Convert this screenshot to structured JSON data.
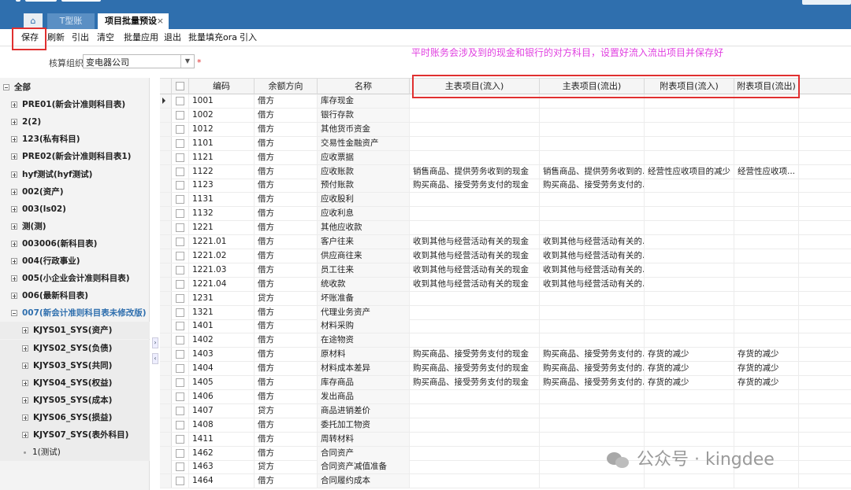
{
  "tabs": {
    "home_icon": "home-icon",
    "t_ledger": "T型账",
    "active": "项目批量预设",
    "close": "×"
  },
  "toolbar": [
    "保存",
    "刷新",
    "引出",
    "清空",
    "批量应用",
    "退出",
    "批量填充ora",
    "引入"
  ],
  "org": {
    "label": "核算组织",
    "value": "变电器公司",
    "required": "*"
  },
  "annotation": "平时账务会涉及到的现金和银行的对方科目，设置好流入流出项目并保存好",
  "tree": [
    {
      "label": "全部",
      "level": 0
    },
    {
      "label": "PRE01(新会计准则科目表)",
      "level": 1
    },
    {
      "label": "2(2)",
      "level": 1
    },
    {
      "label": "123(私有科目)",
      "level": 1
    },
    {
      "label": "PRE02(新会计准则科目表1)",
      "level": 1
    },
    {
      "label": "hyf测试(hyf测试)",
      "level": 1
    },
    {
      "label": "002(资产)",
      "level": 1
    },
    {
      "label": "003(ls02)",
      "level": 1
    },
    {
      "label": "测(测)",
      "level": 1
    },
    {
      "label": "003006(新科目表)",
      "level": 1
    },
    {
      "label": "004(行政事业)",
      "level": 1
    },
    {
      "label": "005(小企业会计准则科目表)",
      "level": 1
    },
    {
      "label": "006(最新科目表)",
      "level": 1
    },
    {
      "label": "007(新会计准则科目表未修改版)",
      "level": 1,
      "selected": true
    },
    {
      "label": "KJYS01_SYS(资产)",
      "level": 2
    },
    {
      "label": "KJYS02_SYS(负债)",
      "level": 2
    },
    {
      "label": "KJYS03_SYS(共同)",
      "level": 2
    },
    {
      "label": "KJYS04_SYS(权益)",
      "level": 2
    },
    {
      "label": "KJYS05_SYS(成本)",
      "level": 2
    },
    {
      "label": "KJYS06_SYS(损益)",
      "level": 2
    },
    {
      "label": "KJYS07_SYS(表外科目)",
      "level": 2
    },
    {
      "label": "1(测试)",
      "level": 3
    }
  ],
  "grid": {
    "headers": [
      "编码",
      "余额方向",
      "名称",
      "主表项目(流入)",
      "主表项目(流出)",
      "附表项目(流入)",
      "附表项目(流出)"
    ],
    "rows": [
      [
        "1001",
        "借方",
        "库存现金",
        "",
        "",
        "",
        ""
      ],
      [
        "1002",
        "借方",
        "银行存款",
        "",
        "",
        "",
        ""
      ],
      [
        "1012",
        "借方",
        "其他货币资金",
        "",
        "",
        "",
        ""
      ],
      [
        "1101",
        "借方",
        "交易性金融资产",
        "",
        "",
        "",
        ""
      ],
      [
        "1121",
        "借方",
        "应收票据",
        "",
        "",
        "",
        ""
      ],
      [
        "1122",
        "借方",
        "应收账款",
        "销售商品、提供劳务收到的现金",
        "销售商品、提供劳务收到的...",
        "经营性应收项目的减少",
        "经营性应收项..."
      ],
      [
        "1123",
        "借方",
        "预付账款",
        "购买商品、接受劳务支付的现金",
        "购买商品、接受劳务支付的...",
        "",
        ""
      ],
      [
        "1131",
        "借方",
        "应收股利",
        "",
        "",
        "",
        ""
      ],
      [
        "1132",
        "借方",
        "应收利息",
        "",
        "",
        "",
        ""
      ],
      [
        "1221",
        "借方",
        "其他应收款",
        "",
        "",
        "",
        ""
      ],
      [
        "1221.01",
        "借方",
        "客户往来",
        "收到其他与经营活动有关的现金",
        "收到其他与经营活动有关的...",
        "",
        ""
      ],
      [
        "1221.02",
        "借方",
        "供应商往来",
        "收到其他与经营活动有关的现金",
        "收到其他与经营活动有关的...",
        "",
        ""
      ],
      [
        "1221.03",
        "借方",
        "员工往来",
        "收到其他与经营活动有关的现金",
        "收到其他与经营活动有关的...",
        "",
        ""
      ],
      [
        "1221.04",
        "借方",
        "统收款",
        "收到其他与经营活动有关的现金",
        "收到其他与经营活动有关的...",
        "",
        ""
      ],
      [
        "1231",
        "贷方",
        "坏账准备",
        "",
        "",
        "",
        ""
      ],
      [
        "1321",
        "借方",
        "代理业务资产",
        "",
        "",
        "",
        ""
      ],
      [
        "1401",
        "借方",
        "材料采购",
        "",
        "",
        "",
        ""
      ],
      [
        "1402",
        "借方",
        "在途物资",
        "",
        "",
        "",
        ""
      ],
      [
        "1403",
        "借方",
        "原材料",
        "购买商品、接受劳务支付的现金",
        "购买商品、接受劳务支付的...",
        "存货的减少",
        "存货的减少"
      ],
      [
        "1404",
        "借方",
        "材料成本差异",
        "购买商品、接受劳务支付的现金",
        "购买商品、接受劳务支付的...",
        "存货的减少",
        "存货的减少"
      ],
      [
        "1405",
        "借方",
        "库存商品",
        "购买商品、接受劳务支付的现金",
        "购买商品、接受劳务支付的...",
        "存货的减少",
        "存货的减少"
      ],
      [
        "1406",
        "借方",
        "发出商品",
        "",
        "",
        "",
        ""
      ],
      [
        "1407",
        "贷方",
        "商品进销差价",
        "",
        "",
        "",
        ""
      ],
      [
        "1408",
        "借方",
        "委托加工物资",
        "",
        "",
        "",
        ""
      ],
      [
        "1411",
        "借方",
        "周转材料",
        "",
        "",
        "",
        ""
      ],
      [
        "1462",
        "借方",
        "合同资产",
        "",
        "",
        "",
        ""
      ],
      [
        "1463",
        "贷方",
        "合同资产减值准备",
        "",
        "",
        "",
        ""
      ],
      [
        "1464",
        "借方",
        "合同履约成本",
        "",
        "",
        "",
        ""
      ]
    ]
  },
  "watermark": "公众号 · kingdee"
}
